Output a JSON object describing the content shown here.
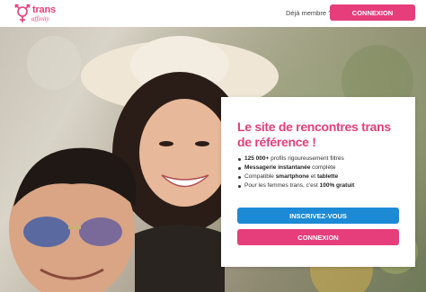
{
  "brand": {
    "name_line1": "trans",
    "name_line2": "affinity",
    "logo_icon": "transgender-symbol-icon",
    "color": "#e63e7a"
  },
  "header": {
    "already_member": "Déjà membre ?",
    "login_label": "CONNEXION"
  },
  "hero": {
    "image": "smiling-couple-photo"
  },
  "card": {
    "title": "Le site de rencontres trans de référence !",
    "features": [
      {
        "bold": "125 000+",
        "text": " profils rigoureusement filtrés",
        "bold2": "",
        "text2": ""
      },
      {
        "bold": "Messagerie instantanée",
        "text": " complète",
        "bold2": "",
        "text2": ""
      },
      {
        "bold": "",
        "text": "Compatible ",
        "bold2": "smartphone",
        "text2": " et ",
        "bold3": "tablette"
      },
      {
        "bold": "",
        "text": "Pour les femmes trans, c'est ",
        "bold2": "100% gratuit",
        "text2": ""
      }
    ],
    "signup_label": "INSCRIVEZ-VOUS",
    "login_label": "CONNEXION"
  },
  "colors": {
    "accent": "#e63e7a",
    "signup": "#1d8ad6"
  }
}
